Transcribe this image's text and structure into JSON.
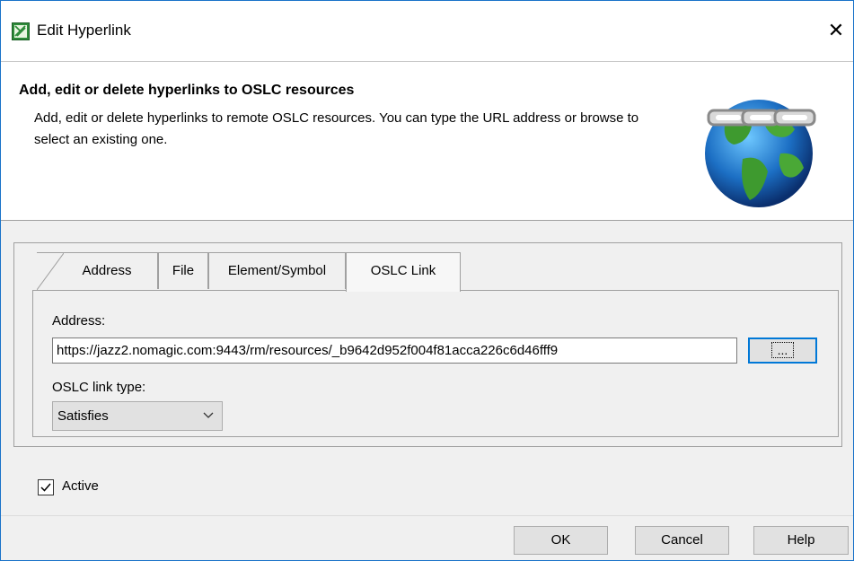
{
  "window": {
    "title": "Edit Hyperlink",
    "icon": "edit-hyperlink-icon",
    "close_glyph": "✕"
  },
  "header": {
    "title": "Add, edit or delete hyperlinks to OSLC resources",
    "description": "Add, edit or delete hyperlinks to remote OSLC resources. You can type the URL address or browse to select an existing one.",
    "image": "globe-link-icon"
  },
  "tabs": [
    {
      "label": "Address"
    },
    {
      "label": "File"
    },
    {
      "label": "Element/Symbol"
    },
    {
      "label": "OSLC Link",
      "active": true
    }
  ],
  "form": {
    "address_label": "Address:",
    "address_value": "https://jazz2.nomagic.com:9443/rm/resources/_b9642d952f004f81acca226c6d46fff9",
    "browse_label": "...",
    "link_type_label": "OSLC link type:",
    "link_type_value": "Satisfies",
    "active_label": "Active",
    "active_checked": true
  },
  "buttons": {
    "ok": "OK",
    "cancel": "Cancel",
    "help": "Help"
  },
  "colors": {
    "accent": "#0078d7",
    "window_border": "#1a73c9"
  }
}
